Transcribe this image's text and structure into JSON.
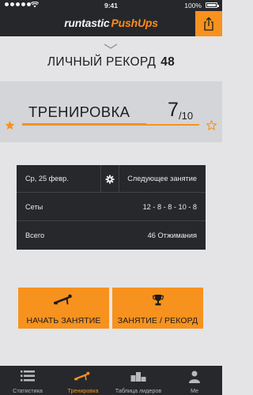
{
  "status_bar": {
    "time": "9:41",
    "battery": "100%"
  },
  "header": {
    "logo_runtastic": "runtastic",
    "logo_pushups": "PushUps",
    "share_icon": "share-icon"
  },
  "personal_record": {
    "label": "ЛИЧНЫЙ РЕКОРД",
    "value": "48"
  },
  "training": {
    "label": "ТРЕНИРОВКА",
    "current": "7",
    "total": "/10"
  },
  "session": {
    "date": "Ср, 25 февр.",
    "next_label": "Следующее занятие",
    "sets_label": "Сеты",
    "sets_value": "12 - 8 - 8 - 10 - 8",
    "total_label": "Всего",
    "total_value": "46 Отжимания"
  },
  "actions": {
    "start_label": "НАЧАТЬ ЗАНЯТИЕ",
    "record_label": "ЗАНЯТИЕ / РЕКОРД"
  },
  "tabs": [
    {
      "label": "Статистика",
      "icon": "list-icon"
    },
    {
      "label": "Тренировка",
      "icon": "pushup-icon"
    },
    {
      "label": "Таблица лидеров",
      "icon": "podium-icon"
    },
    {
      "label": "Ме",
      "icon": "profile-icon"
    }
  ],
  "colors": {
    "accent": "#f7921e",
    "dark": "#26272b",
    "background": "#e4e4e6",
    "band": "#d3d5d9"
  }
}
